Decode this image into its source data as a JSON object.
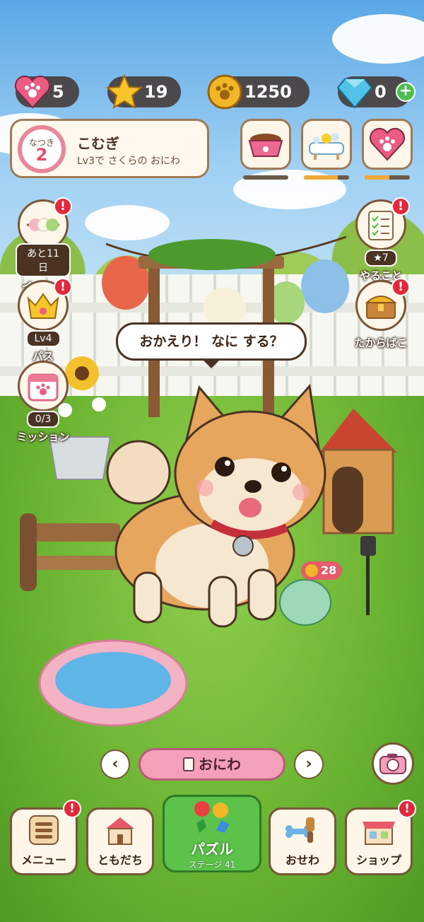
{
  "resources": {
    "hearts": "5",
    "stars": "19",
    "coins": "1250",
    "gems": "0"
  },
  "profile": {
    "level_label": "なつき",
    "level": "2",
    "name": "こむぎ",
    "subtitle": "Lv3で さくらの おにわ"
  },
  "care": [
    {
      "icon": "food-bowl-icon",
      "level": 0.0
    },
    {
      "icon": "bath-icon",
      "level": 0.75
    },
    {
      "icon": "heart-paw-icon",
      "level": 0.55
    }
  ],
  "left_side": [
    {
      "icon": "dango-icon",
      "pill": "あと11日",
      "label": "イベント"
    },
    {
      "icon": "crown-paw-icon",
      "pill": "Lv4",
      "label": "パス"
    },
    {
      "icon": "calendar-paw-icon",
      "pill": "0/3",
      "label": "ミッション"
    }
  ],
  "right_side": [
    {
      "icon": "checklist-icon",
      "pill": "★7",
      "label": "やること"
    },
    {
      "icon": "treasure-chest-icon",
      "pill": "",
      "label": "たからばこ"
    }
  ],
  "speech": "おかえり！ なに する？",
  "pouch_count": "28",
  "area": {
    "name": "おにわ",
    "prev": "‹",
    "next": "›"
  },
  "nav": {
    "menu": "メニュー",
    "friends": "ともだち",
    "puzzle": "パズル",
    "puzzle_stage": "ステージ 41",
    "care": "おせわ",
    "shop": "ショップ"
  },
  "badge_mark": "!",
  "colors": {
    "accent_pink": "#f4a0b9",
    "badge_red": "#e2283a",
    "puzzle_green": "#5cc24a",
    "frame_brown": "#7a5638"
  }
}
